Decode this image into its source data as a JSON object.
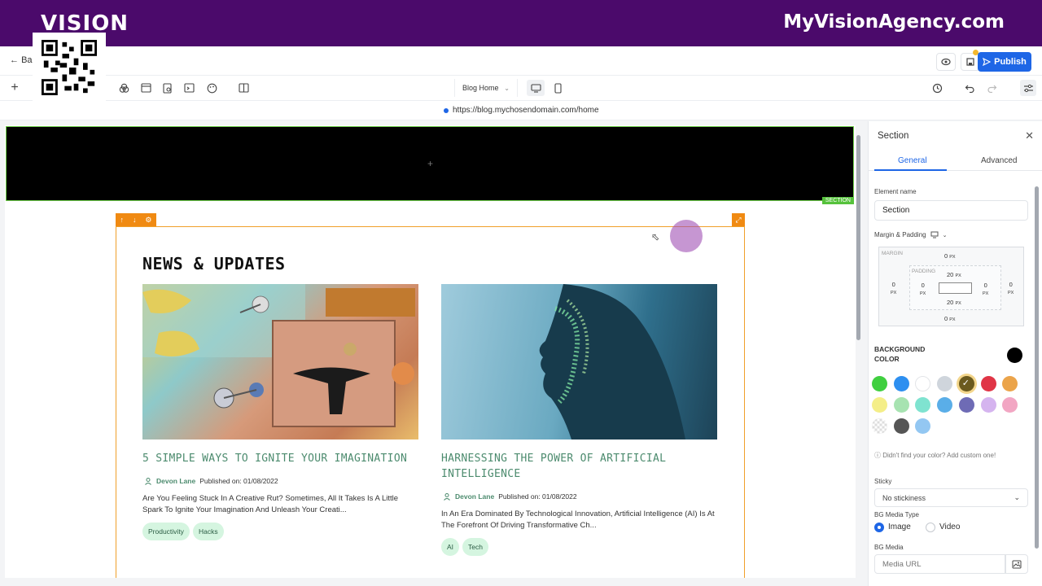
{
  "banner": {
    "logo": "VISION",
    "site": "MyVisionAgency.com"
  },
  "topbar": {
    "back_label": "Back",
    "publish_label": "Publish"
  },
  "toolbar": {
    "page_select": "Blog Home"
  },
  "urlbar": {
    "url": "https://blog.mychosendomain.com/home"
  },
  "canvas": {
    "section_tag": "SECTION",
    "plus": "+",
    "news_title": "NEWS & UPDATES",
    "posts": [
      {
        "title": "5 SIMPLE WAYS TO IGNITE YOUR IMAGINATION",
        "author": "Devon Lane",
        "published": "Published on: 01/08/2022",
        "excerpt": "Are You Feeling Stuck In A Creative Rut? Sometimes, All It Takes Is A Little Spark To Ignite Your Imagination And Unleash Your Creati...",
        "tags": [
          "Productivity",
          "Hacks"
        ]
      },
      {
        "title": "HARNESSING THE POWER OF ARTIFICIAL INTELLIGENCE",
        "author": "Devon Lane",
        "published": "Published on: 01/08/2022",
        "excerpt": "In An Era Dominated By Technological Innovation, Artificial Intelligence (AI) Is At The Forefront Of Driving Transformative Ch...",
        "tags": [
          "AI",
          "Tech"
        ]
      }
    ]
  },
  "panel": {
    "title": "Section",
    "tabs": [
      "General",
      "Advanced"
    ],
    "element_name_label": "Element name",
    "element_name_value": "Section",
    "margin_padding_label": "Margin & Padding",
    "margin_label": "MARGIN",
    "padding_label": "PADDING",
    "margin_top": "0",
    "margin_bottom": "0",
    "margin_left": "0",
    "margin_right": "0",
    "padding_top": "20",
    "padding_bottom": "20",
    "padding_left": "0",
    "padding_right": "0",
    "unit": "PX",
    "bg_color_label": "BACKGROUND COLOR",
    "bg_color_value": "#000000",
    "swatches": [
      "#3fcf3f",
      "#2d8ff0",
      "#ffffff",
      "#cfd5dc",
      "#2b2b2b",
      "#e03546",
      "#eba44a",
      "#f4ee88",
      "#a7e3b1",
      "#7fe3d0",
      "#5aaee8",
      "#6e6bb5",
      "#d5b4ef",
      "#f2a6c3",
      "#dcdcdc",
      "#555555",
      "#93c7f2"
    ],
    "hint": "Didn't find your color? Add custom one!",
    "sticky_label": "Sticky",
    "sticky_value": "No stickiness",
    "bg_media_type_label": "BG Media Type",
    "media_image": "Image",
    "media_video": "Video",
    "bg_media_label": "BG Media",
    "media_url_placeholder": "Media URL"
  }
}
